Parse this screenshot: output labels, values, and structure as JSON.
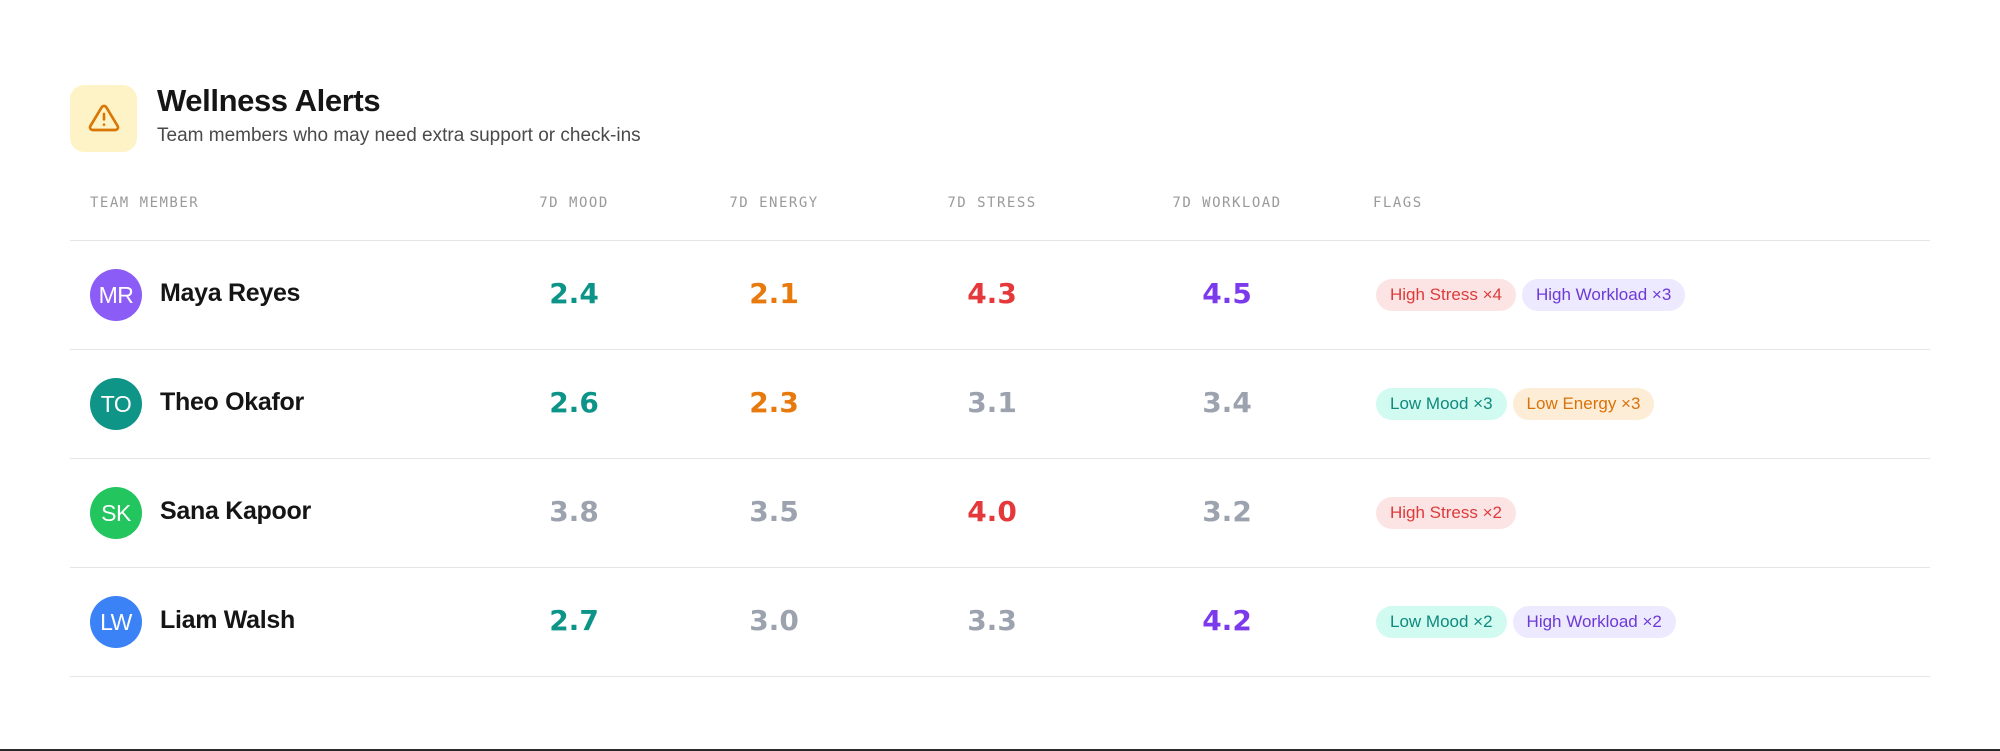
{
  "colors": {
    "mood": "#0d9488",
    "energy": "#e8790c",
    "stress": "#e11d48",
    "workload": "#7c3aed",
    "neutral": "#9ca3af",
    "warn_bg": "#fef3c7",
    "warn_icon": "#d97706"
  },
  "header": {
    "icon": "warning-triangle-icon",
    "title": "Wellness Alerts",
    "subtitle": "Team members who may need extra support or check-ins"
  },
  "columns": {
    "member": "TEAM MEMBER",
    "mood": "7D MOOD",
    "energy": "7D ENERGY",
    "stress": "7D STRESS",
    "workload": "7D WORKLOAD",
    "flags": "FLAGS"
  },
  "rows": [
    {
      "initials": "MR",
      "avatar_color": "#8b5cf6",
      "name": "Maya Reyes",
      "mood": {
        "value": "2.4",
        "color": "#0d9488"
      },
      "energy": {
        "value": "2.1",
        "color": "#e8790c"
      },
      "stress": {
        "value": "4.3",
        "color": "#e5383b"
      },
      "workload": {
        "value": "4.5",
        "color": "#7c3aed"
      },
      "flags": [
        {
          "label": "High Stress ×4",
          "bg": "#fde4e4",
          "fg": "#dc3b3b"
        },
        {
          "label": "High Workload ×3",
          "bg": "#ede9fe",
          "fg": "#6d3ad6"
        }
      ]
    },
    {
      "initials": "TO",
      "avatar_color": "#0f9488",
      "name": "Theo Okafor",
      "mood": {
        "value": "2.6",
        "color": "#0d9488"
      },
      "energy": {
        "value": "2.3",
        "color": "#e8790c"
      },
      "stress": {
        "value": "3.1",
        "color": "#9ca3af"
      },
      "workload": {
        "value": "3.4",
        "color": "#9ca3af"
      },
      "flags": [
        {
          "label": "Low Mood ×3",
          "bg": "#d1faf0",
          "fg": "#0f8a7e"
        },
        {
          "label": "Low Energy ×3",
          "bg": "#feedd6",
          "fg": "#d9720a"
        }
      ]
    },
    {
      "initials": "SK",
      "avatar_color": "#22c55e",
      "name": "Sana Kapoor",
      "mood": {
        "value": "3.8",
        "color": "#9ca3af"
      },
      "energy": {
        "value": "3.5",
        "color": "#9ca3af"
      },
      "stress": {
        "value": "4.0",
        "color": "#e5383b"
      },
      "workload": {
        "value": "3.2",
        "color": "#9ca3af"
      },
      "flags": [
        {
          "label": "High Stress ×2",
          "bg": "#fde4e4",
          "fg": "#dc3b3b"
        }
      ]
    },
    {
      "initials": "LW",
      "avatar_color": "#3b82f6",
      "name": "Liam Walsh",
      "mood": {
        "value": "2.7",
        "color": "#0d9488"
      },
      "energy": {
        "value": "3.0",
        "color": "#9ca3af"
      },
      "stress": {
        "value": "3.3",
        "color": "#9ca3af"
      },
      "workload": {
        "value": "4.2",
        "color": "#7c3aed"
      },
      "flags": [
        {
          "label": "Low Mood ×2",
          "bg": "#d1faf0",
          "fg": "#0f8a7e"
        },
        {
          "label": "High Workload ×2",
          "bg": "#ede9fe",
          "fg": "#6d3ad6"
        }
      ]
    }
  ]
}
